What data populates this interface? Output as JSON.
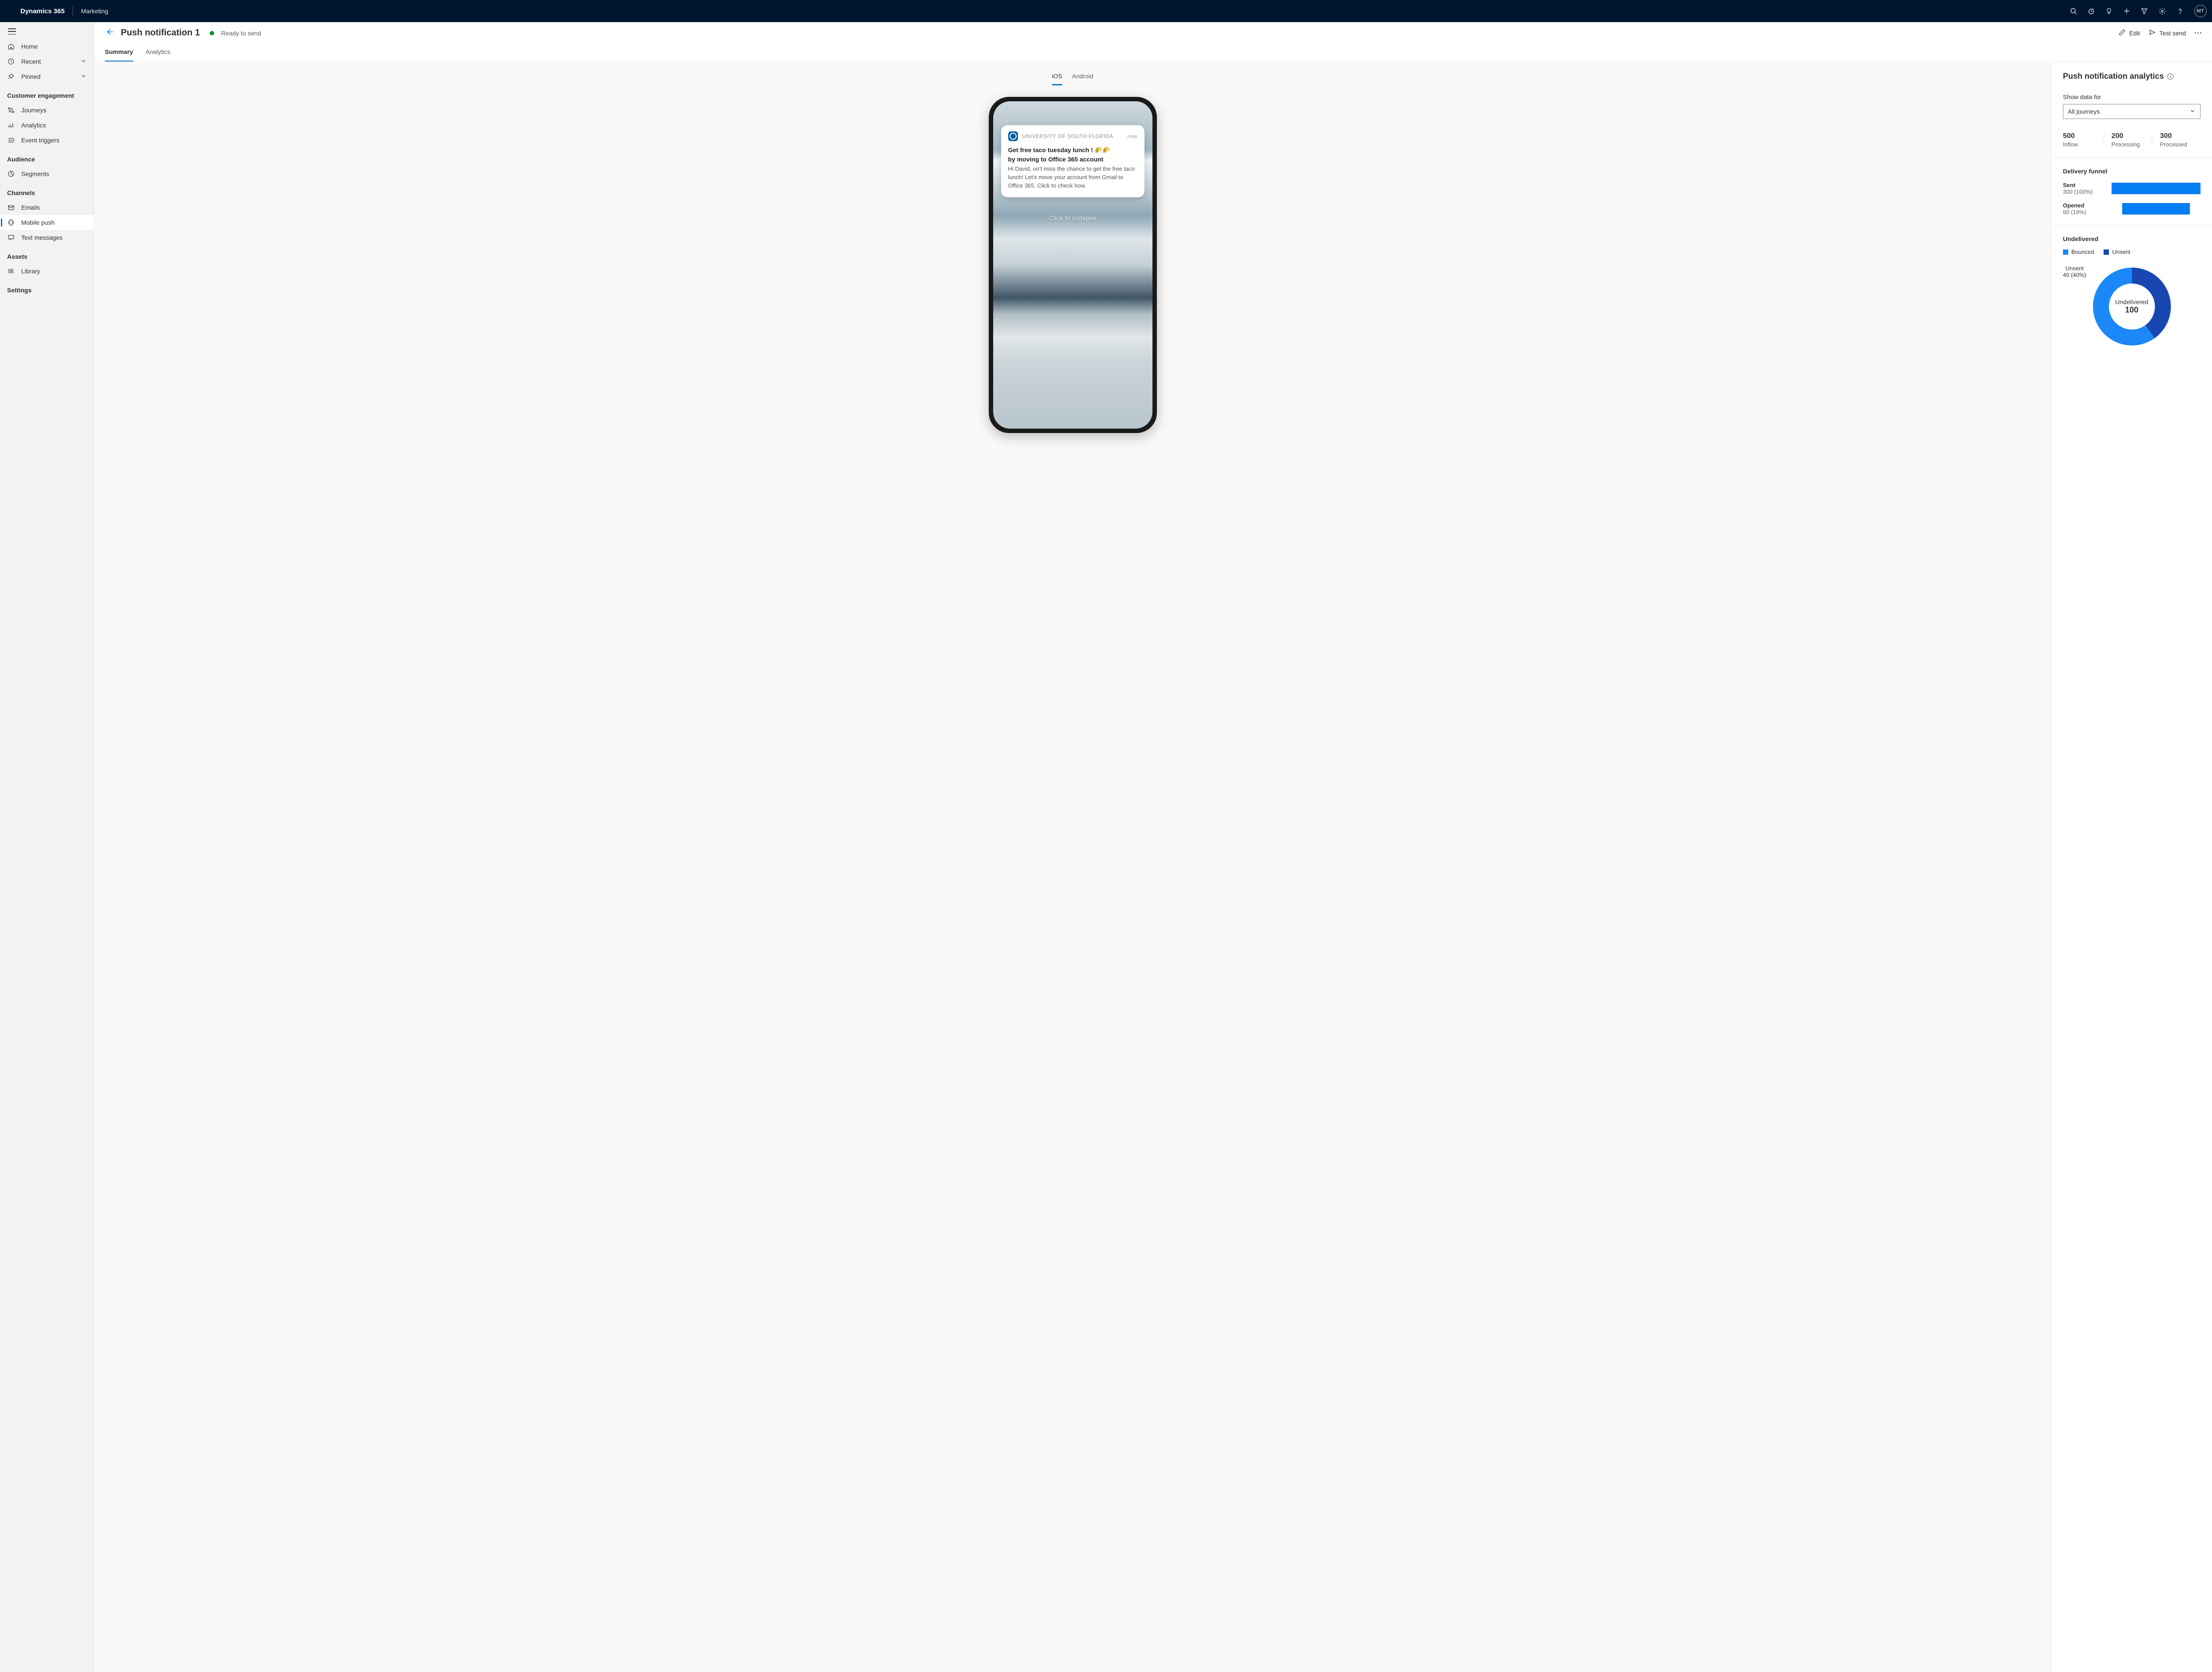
{
  "topbar": {
    "brand": "Dynamics 365",
    "module": "Marketing",
    "avatar": "MT"
  },
  "sidebar": {
    "home": "Home",
    "recent": "Recent",
    "pinned": "Pinned",
    "sections": {
      "engagement": {
        "title": "Customer engagement",
        "journeys": "Journeys",
        "analytics": "Analytics",
        "event_triggers": "Event triggers"
      },
      "audience": {
        "title": "Audience",
        "segments": "Segments"
      },
      "channels": {
        "title": "Channels",
        "emails": "Emails",
        "mobile_push": "Mobile push",
        "text_messages": "Text messages"
      },
      "assets": {
        "title": "Assets",
        "library": "Library"
      },
      "settings": {
        "title": "Settings"
      }
    }
  },
  "header": {
    "title": "Push notification 1",
    "status": "Ready to send",
    "actions": {
      "edit": "Edit",
      "test_send": "Test send"
    },
    "tabs": {
      "summary": "Summary",
      "analytics": "Analytics"
    }
  },
  "preview": {
    "os_tabs": {
      "ios": "iOS",
      "android": "Android"
    },
    "notification": {
      "app_name": "UNIVERSITY OF SOUTH FLORIDA",
      "time": "now",
      "title_line1": "Get free taco tuesday lunch ! 🌮🌮",
      "title_line2": "by moving to Office 365 account",
      "body": "Hi David, on't miss the chance to get the free taco lunch! Let's move your account from Gmail to Office 365. Click to check how.",
      "collapse": "Click to collapse"
    }
  },
  "analytics": {
    "title": "Push notification analytics",
    "filter_label": "Show data for",
    "filter_value": "All journeys",
    "stats": {
      "inflow": {
        "value": "500",
        "label": "Inflow"
      },
      "processing": {
        "value": "200",
        "label": "Processing"
      },
      "processed": {
        "value": "300",
        "label": "Processed"
      }
    },
    "funnel": {
      "title": "Delivery funnel",
      "sent": {
        "name": "Sent",
        "sub": "300 (100%)"
      },
      "opened": {
        "name": "Opened",
        "sub": "60 (19%)"
      }
    },
    "undelivered": {
      "title": "Undelivered",
      "legend": {
        "bounced": "Bounced",
        "unsent": "Unsent"
      },
      "unsent_label": "Unsent",
      "unsent_sub": "40 (40%)",
      "center_label": "Undelivered",
      "center_value": "100"
    }
  },
  "chart_data": [
    {
      "type": "bar",
      "title": "Delivery funnel",
      "categories": [
        "Sent",
        "Opened"
      ],
      "values_pct": [
        100,
        19
      ],
      "values_abs": [
        300,
        60
      ],
      "orientation": "horizontal-funnel",
      "color": "#057ef4"
    },
    {
      "type": "pie",
      "title": "Undelivered",
      "series": [
        {
          "name": "Unsent",
          "value": 40,
          "color": "#1847b2"
        },
        {
          "name": "Bounced",
          "value": 60,
          "color": "#1c88f7"
        }
      ],
      "total_label": "Undelivered",
      "total_value": 100
    }
  ]
}
